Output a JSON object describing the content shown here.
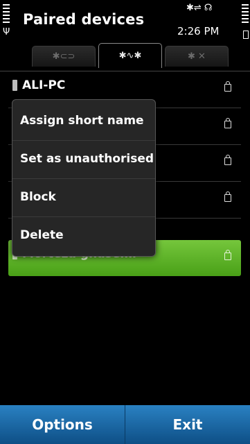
{
  "status": {
    "title": "Paired devices",
    "time": "2:26 PM",
    "icons": "✱⇌ ☊"
  },
  "tabs": [
    {
      "label": "✱⊂⊃",
      "icon": "bluetooth-settings-icon"
    },
    {
      "label": "✱∿✱",
      "icon": "bluetooth-paired-icon"
    },
    {
      "label": "✱ ✕",
      "icon": "bluetooth-blocked-icon"
    }
  ],
  "devices": [
    {
      "name": "ALI-PC"
    },
    {
      "name": ""
    },
    {
      "name": ""
    },
    {
      "name": ""
    },
    {
      "name": "Morteza ghasemi"
    }
  ],
  "menu": {
    "items": [
      "Assign short name",
      "Set as unauthorised",
      "Block",
      "Delete"
    ]
  },
  "softkeys": {
    "left": "Options",
    "right": "Exit"
  },
  "colors": {
    "highlight": "#5fb52a",
    "softkey": "#1f6aa8"
  }
}
